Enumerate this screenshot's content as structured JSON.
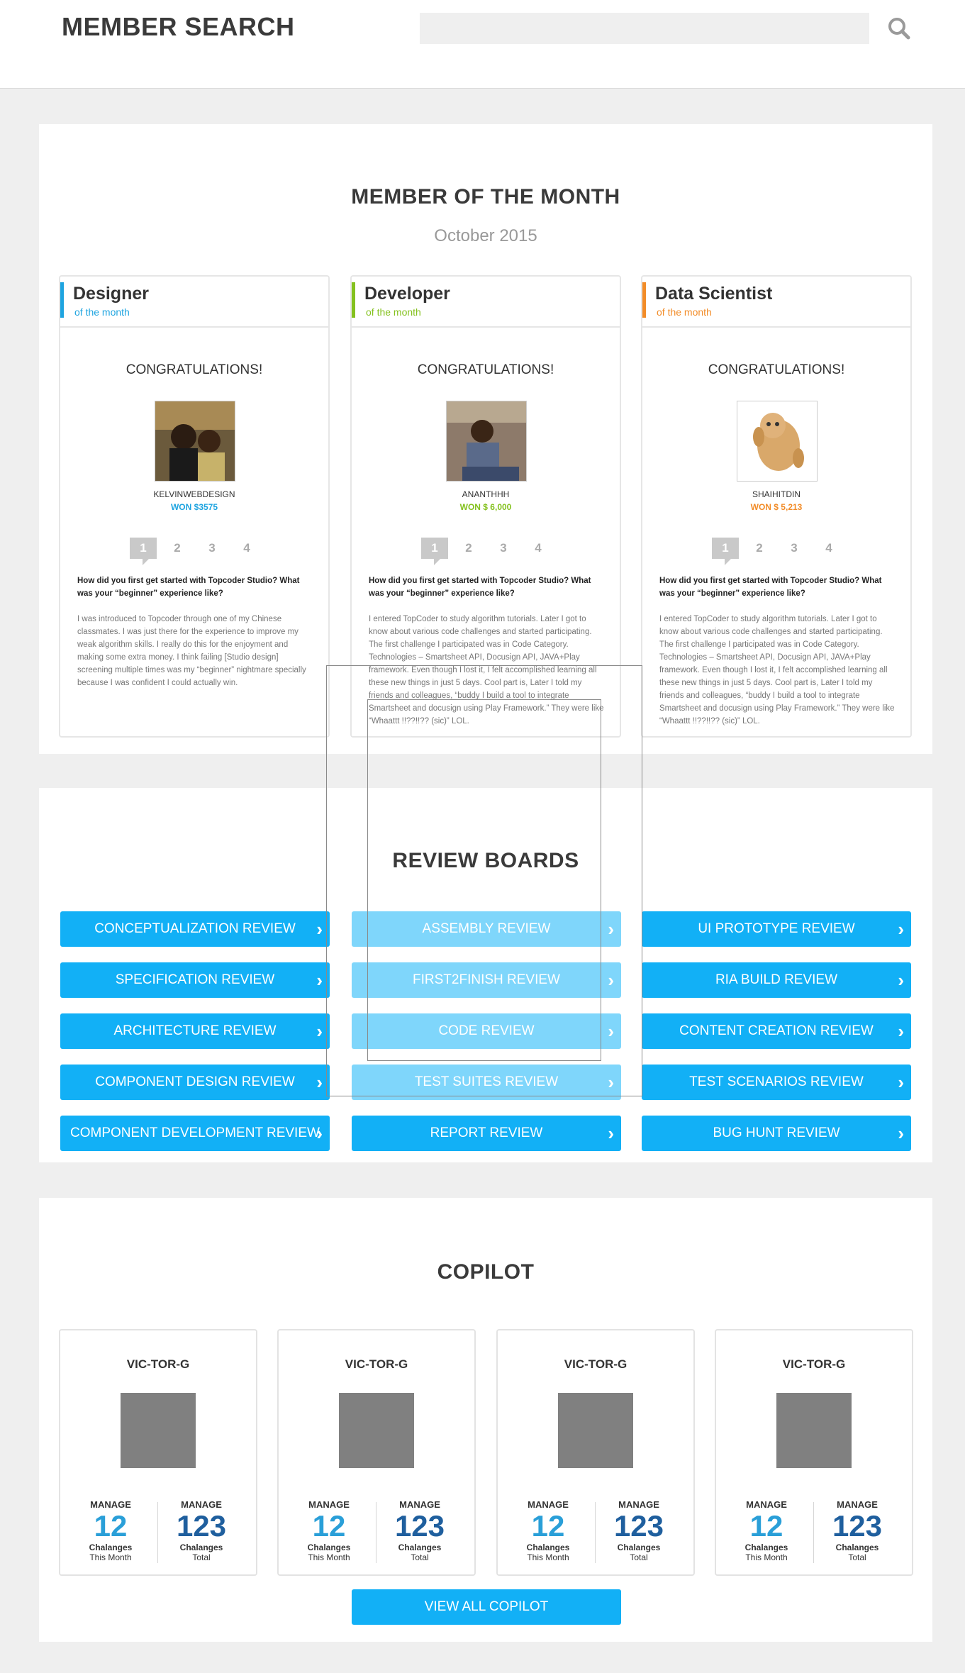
{
  "header": {
    "title": "MEMBER SEARCH",
    "search_placeholder": "",
    "search_icon": "search-icon"
  },
  "member_of_month": {
    "title": "MEMBER OF THE MONTH",
    "period": "October 2015",
    "cards": [
      {
        "role": "Designer",
        "role_sub": "of the month",
        "accent": "#1ea4e0",
        "congrats": "CONGRATULATIONS!",
        "handle": "KELVINWEBDESIGN",
        "won": "WON $3575",
        "pages": [
          "1",
          "2",
          "3",
          "4"
        ],
        "question": "How did you first get started with Topcoder Studio? What was your “beginner” experience like?",
        "answer": "I was introduced to Topcoder through one of my Chinese classmates. I was just there for the experience to improve my weak algorithm skills. I really do this for the enjoyment and making some extra money. I think failing [Studio design] screening multiple times was my “beginner” nightmare specially because I was confident I could actually win."
      },
      {
        "role": "Developer",
        "role_sub": "of the month",
        "accent": "#84c11e",
        "congrats": "CONGRATULATIONS!",
        "handle": "ANANTHHH",
        "won": "WON $ 6,000",
        "pages": [
          "1",
          "2",
          "3",
          "4"
        ],
        "question": "How did you first get started with Topcoder Studio? What was your “beginner” experience like?",
        "answer": "I entered TopCoder to study algorithm tutorials. Later I got to know about various code challenges and started participating. The first challenge I participated was in Code Category. Technologies – Smartsheet API, Docusign API, JAVA+Play framework. Even though I lost it, I felt accomplished learning all these new things in just 5 days. Cool part is, Later I told my friends and colleagues, “buddy I build a tool to integrate Smartsheet and docusign using Play Framework.” They were like “Whaattt !!??!!?? (sic)” LOL."
      },
      {
        "role": "Data Scientist",
        "role_sub": "of the month",
        "accent": "#f28c28",
        "congrats": "CONGRATULATIONS!",
        "handle": "SHAIHITDIN",
        "won": "WON $ 5,213",
        "pages": [
          "1",
          "2",
          "3",
          "4"
        ],
        "question": "How did you first get started with Topcoder Studio? What was your “beginner” experience like?",
        "answer": "I entered TopCoder to study algorithm tutorials. Later I got to know about various code challenges and started participating. The first challenge I participated was in Code Category. Technologies – Smartsheet API, Docusign API, JAVA+Play framework. Even though I lost it, I felt accomplished learning all these new things in just 5 days. Cool part is, Later I told my friends and colleagues, “buddy I build a tool to integrate Smartsheet and docusign using Play Framework.” They were like “Whaattt !!??!!?? (sic)” LOL."
      }
    ]
  },
  "review_boards": {
    "title": "REVIEW BOARDS",
    "columns": [
      [
        "CONCEPTUALIZATION REVIEW",
        "SPECIFICATION REVIEW",
        "ARCHITECTURE REVIEW",
        "COMPONENT DESIGN REVIEW",
        "COMPONENT DEVELOPMENT REVIEW"
      ],
      [
        "ASSEMBLY REVIEW",
        "FIRST2FINISH REVIEW",
        "CODE REVIEW",
        "TEST SUITES REVIEW",
        "REPORT REVIEW"
      ],
      [
        "UI PROTOTYPE REVIEW",
        "RIA BUILD REVIEW",
        "CONTENT CREATION REVIEW",
        "TEST SCENARIOS REVIEW",
        "BUG HUNT REVIEW"
      ]
    ],
    "chevron": "›"
  },
  "copilot": {
    "title": "COPILOT",
    "cards": [
      {
        "name": "VIC-TOR-G",
        "manage_label": "MANAGE",
        "month_value": "12",
        "month_cap": "Chalanges",
        "month_cap2": "This Month",
        "total_value": "123",
        "total_cap": "Chalanges",
        "total_cap2": "Total"
      },
      {
        "name": "VIC-TOR-G",
        "manage_label": "MANAGE",
        "month_value": "12",
        "month_cap": "Chalanges",
        "month_cap2": "This Month",
        "total_value": "123",
        "total_cap": "Chalanges",
        "total_cap2": "Total"
      },
      {
        "name": "VIC-TOR-G",
        "manage_label": "MANAGE",
        "month_value": "12",
        "month_cap": "Chalanges",
        "month_cap2": "This Month",
        "total_value": "123",
        "total_cap": "Chalanges",
        "total_cap2": "Total"
      },
      {
        "name": "VIC-TOR-G",
        "manage_label": "MANAGE",
        "month_value": "12",
        "month_cap": "Chalanges",
        "month_cap2": "This Month",
        "total_value": "123",
        "total_cap": "Chalanges",
        "total_cap2": "Total"
      }
    ],
    "view_all": "VIEW ALL COPILOT",
    "month_color": "#2a9fd8",
    "total_color": "#1f5f9e"
  }
}
